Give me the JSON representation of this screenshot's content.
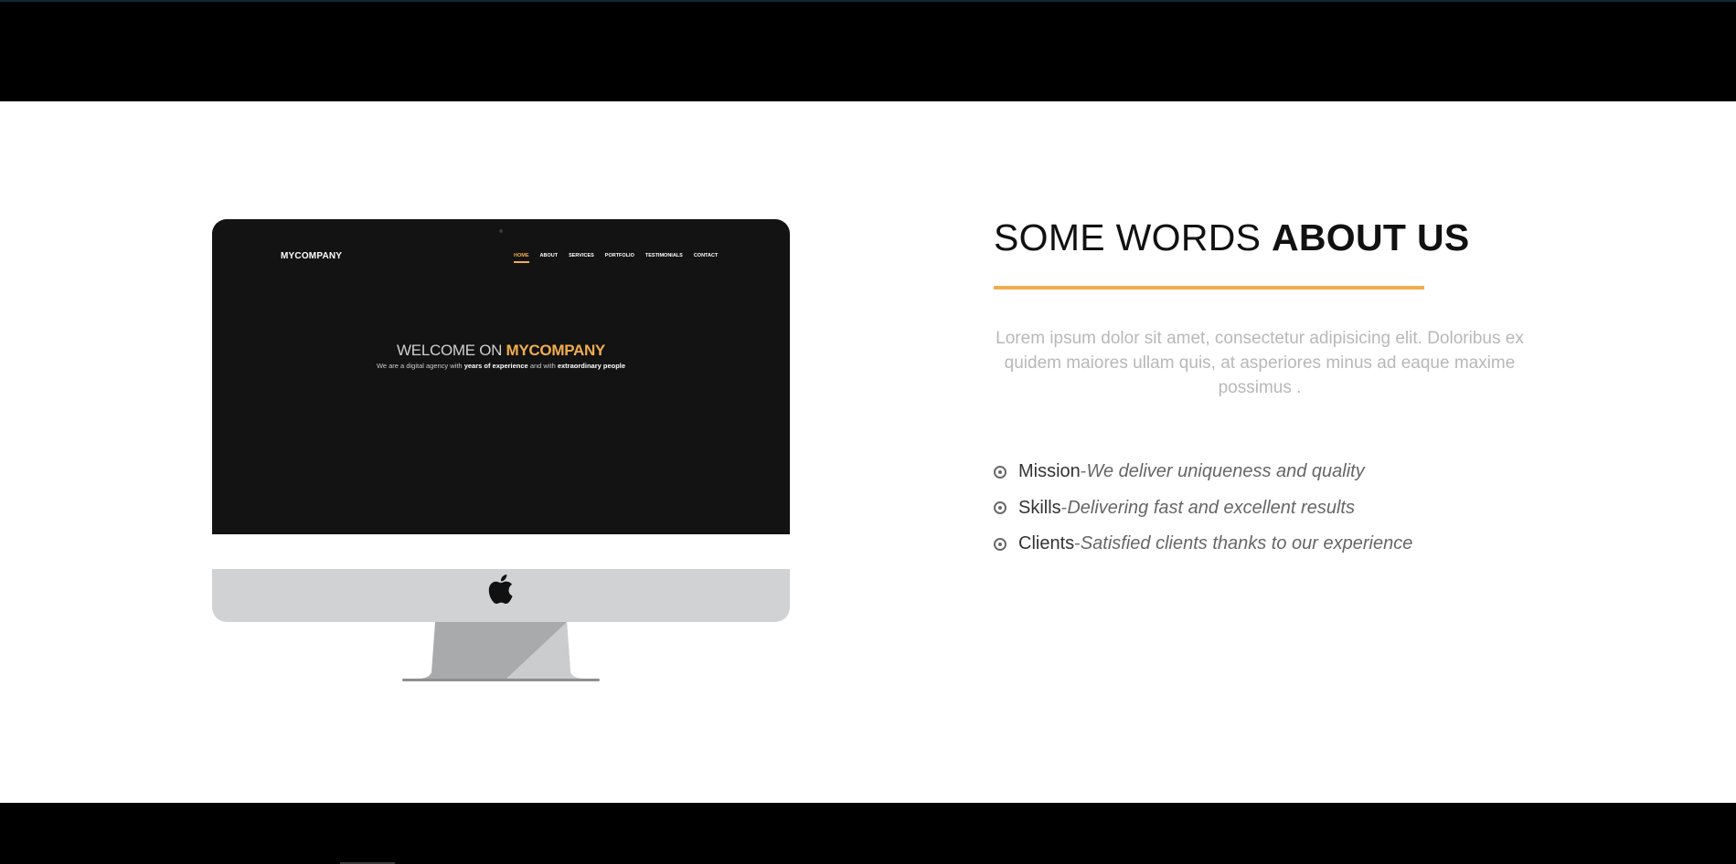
{
  "mockup": {
    "brand": "MYCOMPANY",
    "nav": [
      "HOME",
      "ABOUT",
      "SERVICES",
      "PORTFOLIO",
      "TESTIMONIALS",
      "CONTACT"
    ],
    "hero_prefix": "WELCOME ON ",
    "hero_brand": "MYCOMPANY",
    "sub_1": "We are a digital agency with ",
    "sub_2": "years of experience",
    "sub_3": " and with ",
    "sub_4": "extraordinary people"
  },
  "about": {
    "title_light": "SOME WORDS ",
    "title_bold": "ABOUT US",
    "lead": "Lorem ipsum dolor sit amet, consectetur adipisicing elit. Doloribus ex quidem maiores ullam quis, at asperiores minus ad eaque maxime possimus .",
    "items": [
      {
        "term": "Mission",
        "sep": " - ",
        "desc": "We deliver uniqueness and quality"
      },
      {
        "term": "Skills",
        "sep": " - ",
        "desc": "Delivering fast and excellent results"
      },
      {
        "term": "Clients",
        "sep": " - ",
        "desc": "Satisfied clients thanks to our experience"
      }
    ]
  },
  "colors": {
    "accent": "#f0ad4e",
    "band": "#000000"
  },
  "icons": [
    "apple-icon",
    "dot-circle-icon"
  ]
}
